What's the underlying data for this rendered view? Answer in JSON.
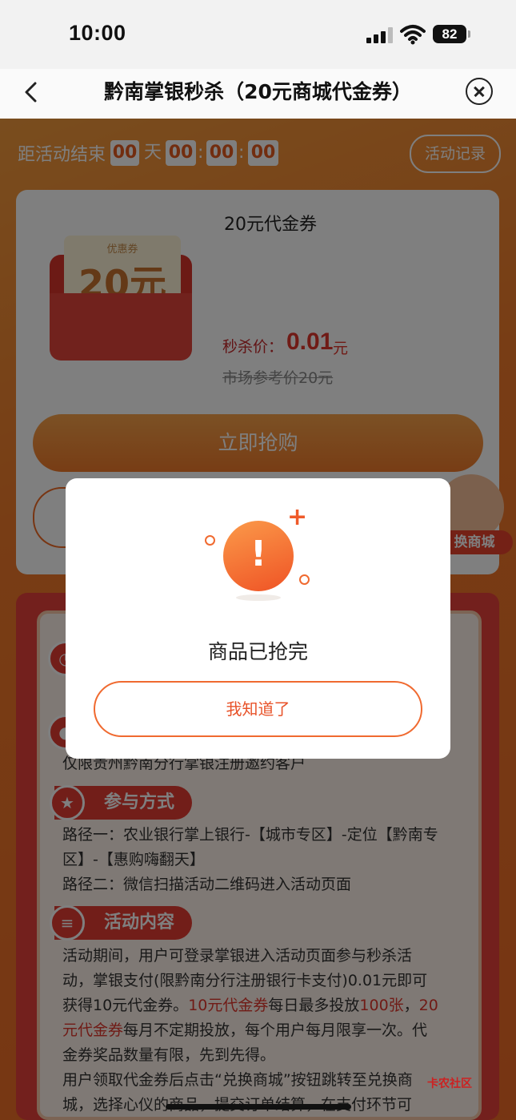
{
  "status_bar": {
    "time": "10:00",
    "battery": "82"
  },
  "nav": {
    "title": "黔南掌银秒杀（20元商城代金券）",
    "back_icon": "chevron-left-icon",
    "close_icon": "close-circle-icon"
  },
  "countdown": {
    "label": "距活动结束",
    "days": "00",
    "day_unit": "天",
    "hours": "00",
    "minutes": "00",
    "seconds": "00",
    "sep": ":"
  },
  "records_button": "活动记录",
  "product": {
    "coupon_tag": "优惠券",
    "coupon_amount": "20元",
    "title": "20元代金券",
    "price_label": "秒杀价：",
    "price_value": "0.01",
    "price_unit": "元",
    "market_price": "市场参考价20元"
  },
  "buy_button": "立即抢购",
  "float_shop_label": "换商城",
  "rules": {
    "eligibility_text": "仅限贵州黔南分行掌银注册邀约客户",
    "participation": {
      "title": "参与方式",
      "lines": [
        "路径一：农业银行掌上银行-【城市专区】-定位【黔南专",
        "区】-【惠购嗨翻天】",
        "路径二：微信扫描活动二维码进入活动页面"
      ]
    },
    "content": {
      "title": "活动内容",
      "p1_a": "活动期间，用户可登录掌银进入活动页面参与秒杀活",
      "p1_b": "动，掌银支付(限黔南分行注册银行卡支付)0.01元即可",
      "p1_c_pre": "获得10元代金券。",
      "p1_c_red1": "10元代金券",
      "p1_c_mid": "每日最多投放",
      "p1_c_red2": "100张",
      "p1_c_sep": "，",
      "p1_c_red3": "20",
      "p1_d_red": "元代金券",
      "p1_d_rest": "每月不定期投放，每个用户每月限享一次。代",
      "p1_e": "金券奖品数量有限，先到先得。",
      "p2_a": "用户领取代金券后点击“兑换商城”按钮跳转至兑换商",
      "p2_b": "城，选择心仪的商品，提交订单结算，在支付环节可"
    }
  },
  "dialog": {
    "message": "商品已抢完",
    "ok_button": "我知道了"
  },
  "watermark": "卡农社区",
  "colors": {
    "accent": "#f07a2a",
    "price_red": "#e0362c",
    "overlay": "rgba(0,0,0,0.5)"
  }
}
